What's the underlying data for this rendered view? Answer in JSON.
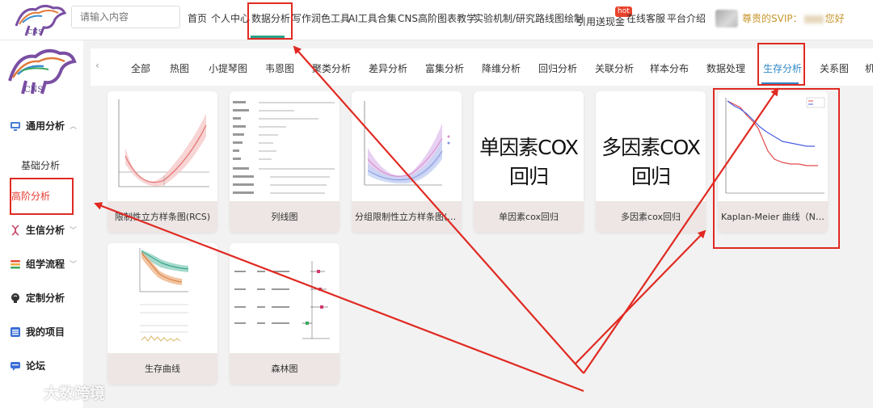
{
  "search": {
    "placeholder": "请输入内容"
  },
  "topnav": [
    {
      "label": "首页"
    },
    {
      "label": "个人中心"
    },
    {
      "label": "数据分析"
    },
    {
      "label": "写作润色工具"
    },
    {
      "label": "AI工具合集"
    },
    {
      "label": "CNS高阶图表教学"
    },
    {
      "label": "实验机制/研究路线图绘制"
    },
    {
      "label": "引用送现金"
    },
    {
      "label": "在线客服"
    },
    {
      "label": "平台介绍"
    }
  ],
  "hot_badge": "hot",
  "user": {
    "prefix": "尊贵的SVIP：",
    "suffix": "您好"
  },
  "sidebar": {
    "groups": [
      {
        "label": "通用分析"
      },
      {
        "label": "基础分析"
      },
      {
        "label": "高阶分析"
      },
      {
        "label": "生信分析"
      },
      {
        "label": "组学流程"
      },
      {
        "label": "定制分析"
      },
      {
        "label": "我的项目"
      },
      {
        "label": "论坛"
      }
    ]
  },
  "tabs": [
    {
      "label": "全部"
    },
    {
      "label": "热图"
    },
    {
      "label": "小提琴图"
    },
    {
      "label": "韦恩图"
    },
    {
      "label": "聚类分析"
    },
    {
      "label": "差异分析"
    },
    {
      "label": "富集分析"
    },
    {
      "label": "降维分析"
    },
    {
      "label": "回归分析"
    },
    {
      "label": "关联分析"
    },
    {
      "label": "样本分布"
    },
    {
      "label": "数据处理"
    },
    {
      "label": "生存分析"
    },
    {
      "label": "关系图"
    },
    {
      "label": "机"
    }
  ],
  "cards": [
    {
      "caption": "限制性立方样条图(RCS)"
    },
    {
      "caption": "列线图"
    },
    {
      "caption": "分组限制性立方样条图(Grou..."
    },
    {
      "caption": "单因素cox回归",
      "big": "单因素COX回归"
    },
    {
      "caption": "多因素cox回归",
      "big": "多因素COX回归"
    },
    {
      "caption": "Kaplan-Meier 曲线（Natur..."
    },
    {
      "caption": "生存曲线"
    },
    {
      "caption": "森林图"
    }
  ],
  "watermark": "大数跨境",
  "colors": {
    "accent_teal": "#2aa08c",
    "accent_blue": "#2f88c8",
    "annotation_red": "#e02a22",
    "active_sidebar": "#e53a2f"
  }
}
